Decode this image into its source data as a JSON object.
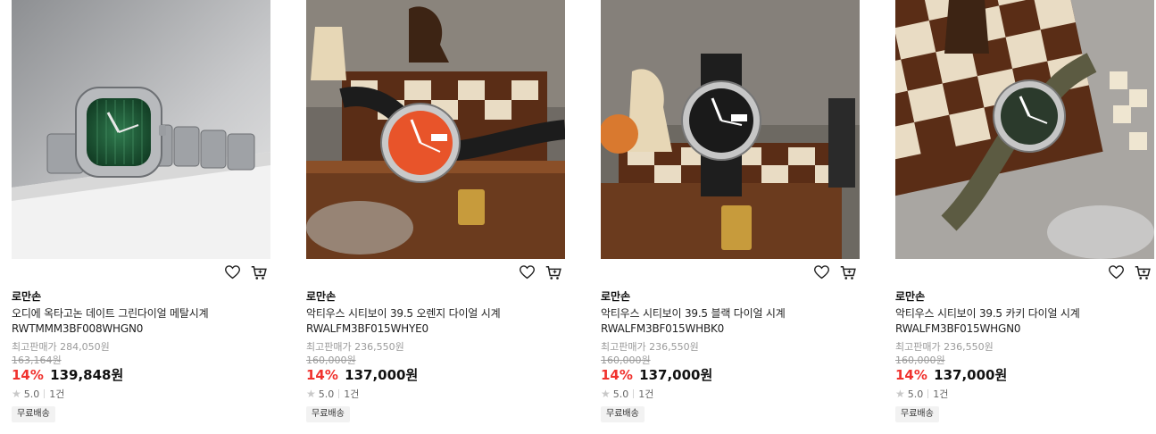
{
  "products": [
    {
      "brand": "로만손",
      "title": "오디에 옥타고논 데이트 그린다이얼 메탈시계 RWTMMM3BF008WHGN0",
      "max_price": "최고판매가 284,050원",
      "original_price": "163,164원",
      "discount": "14%",
      "sale_price": "139,848원",
      "rating": "5.0",
      "review_count": "1건",
      "badge": "무료배송",
      "dial_color": "#1f5a3a",
      "image_alt": "green dial metal watch"
    },
    {
      "brand": "로만손",
      "title": "악티우스 시티보이 39.5 오렌지 다이얼 시계 RWALFM3BF015WHYE0",
      "max_price": "최고판매가 236,550원",
      "original_price": "160,000원",
      "discount": "14%",
      "sale_price": "137,000원",
      "rating": "5.0",
      "review_count": "1건",
      "badge": "무료배송",
      "dial_color": "#e8542a",
      "image_alt": "orange dial watch on chess box"
    },
    {
      "brand": "로만손",
      "title": "악티우스 시티보이 39.5 블랙 다이얼 시계 RWALFM3BF015WHBK0",
      "max_price": "최고판매가 236,550원",
      "original_price": "160,000원",
      "discount": "14%",
      "sale_price": "137,000원",
      "rating": "5.0",
      "review_count": "1건",
      "badge": "무료배송",
      "dial_color": "#1a1a1a",
      "image_alt": "black dial watch on chess box"
    },
    {
      "brand": "로만손",
      "title": "악티우스 시티보이 39.5 카키 다이얼 시계 RWALFM3BF015WHGN0",
      "max_price": "최고판매가 236,550원",
      "original_price": "160,000원",
      "discount": "14%",
      "sale_price": "137,000원",
      "rating": "5.0",
      "review_count": "1건",
      "badge": "무료배송",
      "dial_color": "#2b3a2c",
      "image_alt": "khaki dial watch on chess board"
    }
  ],
  "colors": {
    "discount": "#f0322e",
    "muted": "#9a9a9a",
    "badge_bg": "#f2f2f2"
  },
  "icons": [
    "heart-icon",
    "cart-icon",
    "star-icon"
  ]
}
